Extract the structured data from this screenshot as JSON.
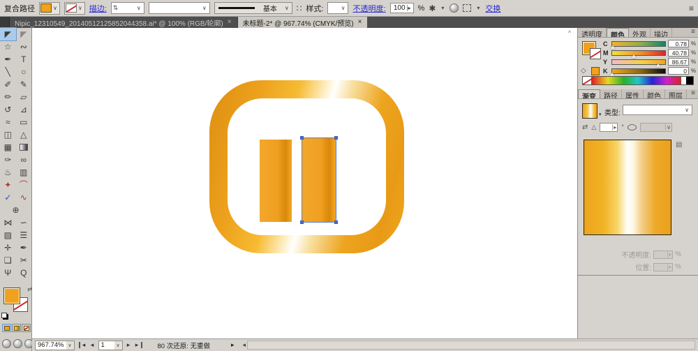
{
  "control_bar": {
    "selection_label": "复合路径",
    "stroke_label": "描边:",
    "brush_basic_label": "基本",
    "style_label": "样式:",
    "opacity_label": "不透明度:",
    "opacity_value": "100",
    "percent": "%",
    "swap_label": "交换"
  },
  "icons": {
    "dropdown": "∨",
    "caret": "▾",
    "spinner": "⇅",
    "close": "×",
    "menu": "≡",
    "dots": "∷",
    "recolor": "✱",
    "swap_arrows": "⇄",
    "angle": "△",
    "arrow_right": "▸",
    "arrow_left": "◂",
    "scroll_up": "^",
    "cube": "◇",
    "gradient_options": "▤",
    "degree": "°"
  },
  "tabs": {
    "doc1": {
      "label": "Nipic_12310549_20140512125852044358.ai* @ 100% (RGB/轮廓)",
      "active": false
    },
    "doc2": {
      "label": "未标题-2* @ 967.74% (CMYK/预览)",
      "active": true
    }
  },
  "toolbar": {
    "tools": [
      {
        "name": "selection-tool",
        "glyph": "◤",
        "selected": true
      },
      {
        "name": "direct-selection-tool",
        "glyph": "◤",
        "color": "#8a8a8a"
      },
      {
        "name": "magic-wand-tool",
        "glyph": "☆"
      },
      {
        "name": "lasso-tool",
        "glyph": "∾"
      },
      {
        "name": "pen-tool",
        "glyph": "✒"
      },
      {
        "name": "type-tool",
        "glyph": "T"
      },
      {
        "name": "line-segment-tool",
        "glyph": "╲"
      },
      {
        "name": "ellipse-tool",
        "glyph": "○"
      },
      {
        "name": "paintbrush-tool",
        "glyph": "✐"
      },
      {
        "name": "pencil-tool",
        "glyph": "✎"
      },
      {
        "name": "blob-brush-tool",
        "glyph": "✏"
      },
      {
        "name": "eraser-tool",
        "glyph": "▱"
      },
      {
        "name": "rotate-tool",
        "glyph": "↺"
      },
      {
        "name": "scale-tool",
        "glyph": "⊿"
      },
      {
        "name": "width-tool",
        "glyph": "≈"
      },
      {
        "name": "free-transform-tool",
        "glyph": "▭"
      },
      {
        "name": "shape-builder-tool",
        "glyph": "◫"
      },
      {
        "name": "perspective-grid-tool",
        "glyph": "△"
      },
      {
        "name": "mesh-tool",
        "glyph": "▦"
      },
      {
        "name": "gradient-tool",
        "chip": true
      },
      {
        "name": "eyedropper-tool",
        "glyph": "✑"
      },
      {
        "name": "blend-tool",
        "glyph": "∞"
      },
      {
        "name": "symbol-sprayer-tool",
        "glyph": "♨"
      },
      {
        "name": "column-graph-tool",
        "glyph": "▥"
      },
      {
        "name": "live-paint-bucket-tool",
        "glyph": "✦",
        "color": "#b3392f"
      },
      {
        "name": "live-paint-selection-tool",
        "glyph": "⌒",
        "color": "#b3392f"
      },
      {
        "name": "path-smooth-tool",
        "glyph": "✓",
        "color": "#2b50b8"
      },
      {
        "name": "wave-tool",
        "glyph": "∿",
        "color": "#b3392f"
      },
      {
        "name": "perspective-selection-tool",
        "glyph": "⊕",
        "wide": true
      },
      {
        "name": "warp-tool",
        "glyph": "⋈"
      },
      {
        "name": "wrinkle-tool",
        "glyph": "∽"
      },
      {
        "name": "crystallize-tool",
        "glyph": "▨"
      },
      {
        "name": "symbol-shifter-tool",
        "glyph": "☰"
      },
      {
        "name": "measure-tool",
        "glyph": "✛"
      },
      {
        "name": "calligraphy-pen-tool",
        "glyph": "✒"
      },
      {
        "name": "artboard-tool",
        "glyph": "❏"
      },
      {
        "name": "slice-tool",
        "glyph": "✂"
      },
      {
        "name": "hand-tool",
        "glyph": "Ψ"
      },
      {
        "name": "zoom-tool",
        "glyph": "Q"
      }
    ]
  },
  "panels": {
    "color": {
      "tabs": [
        "透明度",
        "颜色",
        "外观",
        "描边"
      ],
      "active_tab": "颜色",
      "percent": "%",
      "sliders": [
        {
          "label": "C",
          "value": "0.78",
          "pct": 1,
          "stops": [
            "#f7b02a",
            "#8fae47 55%",
            "#0c8668"
          ]
        },
        {
          "label": "M",
          "value": "40.78",
          "pct": 41,
          "stops": [
            "#f3e13c",
            "#ef8f2a 55%",
            "#dd2428"
          ]
        },
        {
          "label": "Y",
          "value": "86.67",
          "pct": 87,
          "stops": [
            "#f2bcc9",
            "#f6cf4b 55%",
            "#f2a41f"
          ]
        },
        {
          "label": "K",
          "value": "0",
          "pct": 0,
          "stops": [
            "#f2a91f",
            "#8a6612 55%",
            "#0a0a08"
          ]
        }
      ]
    },
    "gradient": {
      "tabs": [
        "渐变",
        "路径",
        "属性",
        "颜色",
        "图层"
      ],
      "active_tab": "渐变",
      "type_label": "类型:",
      "opacity_label": "不透明度:",
      "location_label": "位置:",
      "percent": "%"
    }
  },
  "statusbar": {
    "zoom": "967.74%",
    "artboard": "1",
    "undo_text": "80 次还原: 无重做"
  },
  "colors": {
    "accent_orange": "#f0a21e",
    "selection_blue": "#4a6fd1",
    "link_blue": "#2a2ace"
  }
}
